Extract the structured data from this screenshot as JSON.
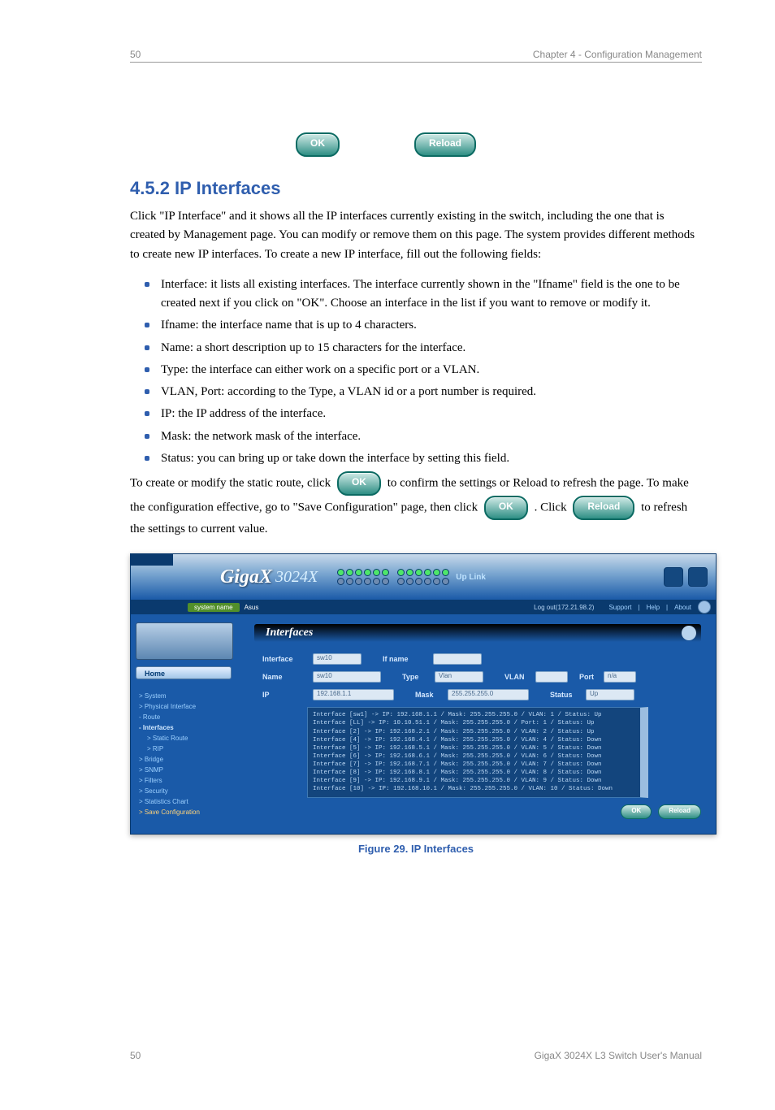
{
  "header": {
    "page_no_top": "50",
    "doc_title": "Chapter 4 - Configuration Management"
  },
  "buttons": {
    "ok": "OK",
    "reload": "Reload"
  },
  "section": {
    "title": "4.5.2 IP Interfaces",
    "para1": "Click \"IP Interface\" and it shows all the IP interfaces currently existing in the switch, including the one that is created by Management page. You can modify or remove them on this page. The system provides different methods to create new IP interfaces. To create a new IP interface, fill out the following fields:",
    "bullets": [
      "Interface: it lists all existing interfaces. The interface currently shown in the \"Ifname\" field is the one to be created next if you click on \"OK\". Choose an interface in the list if you want to remove or modify it.",
      "Ifname: the interface name that is up to 4 characters.",
      "Name: a short description up to 15 characters for the interface.",
      "Type: the interface can either work on a specific port or a VLAN.",
      "VLAN, Port: according to the Type, a VLAN id or a port number is required.",
      "IP: the IP address of the interface.",
      "Mask: the network mask of the interface.",
      "Status: you can bring up or take down the interface by setting this field."
    ],
    "para2_a": "To create or modify the static route, click ",
    "para2_b": " to confirm the settings or Reload to refresh the page. To make the configuration effective, go to \"Save Configuration\" page, then click ",
    "para2_c": ". Click ",
    "para2_d": " to refresh the settings to current value."
  },
  "figure": {
    "caption": "Figure 29. IP Interfaces",
    "logo": "GigaX",
    "model": "3024X",
    "uplink": "Up Link",
    "system_name_label": "system name",
    "system_name": "Asus",
    "logout": "Log out(172.21.98.2)",
    "top_links": [
      "Support",
      "Help",
      "About"
    ],
    "home": "Home",
    "nav": [
      {
        "label": "> System"
      },
      {
        "label": "> Physical Interface"
      },
      {
        "label": "- Route"
      },
      {
        "label": "- Interfaces",
        "bold": true
      },
      {
        "label": "> Static Route",
        "sub": true
      },
      {
        "label": "> RIP",
        "sub": true
      },
      {
        "label": "> Bridge"
      },
      {
        "label": "> SNMP"
      },
      {
        "label": "> Filters"
      },
      {
        "label": "> Security"
      },
      {
        "label": "> Statistics Chart"
      },
      {
        "label": "> Save Configuration",
        "save": true
      }
    ],
    "panel_title": "Interfaces",
    "form": {
      "interface_label": "Interface",
      "interface_value": "sw10",
      "ifname_label": "If name",
      "ifname_value": "",
      "name_label": "Name",
      "name_value": "sw10",
      "type_label": "Type",
      "type_value": "Vlan",
      "vlan_label": "VLAN",
      "vlan_value": "",
      "port_label": "Port",
      "port_value": "n/a",
      "ip_label": "IP",
      "ip_value": "192.168.1.1",
      "mask_label": "Mask",
      "mask_value": "255.255.255.0",
      "status_label": "Status",
      "status_value": "Up"
    },
    "listing": [
      "Interface [sw1] -> IP: 192.168.1.1 / Mask: 255.255.255.0 / VLAN: 1 / Status: Up",
      "Interface [LL] -> IP: 10.10.51.1 / Mask: 255.255.255.0 / Port: 1 / Status: Up",
      "Interface [2] -> IP: 192.168.2.1 / Mask: 255.255.255.0 / VLAN: 2 / Status: Up",
      "Interface [4] -> IP: 192.168.4.1 / Mask: 255.255.255.0 / VLAN: 4 / Status: Down",
      "Interface [5] -> IP: 192.168.5.1 / Mask: 255.255.255.0 / VLAN: 5 / Status: Down",
      "Interface [6] -> IP: 192.168.6.1 / Mask: 255.255.255.0 / VLAN: 6 / Status: Down",
      "Interface [7] -> IP: 192.168.7.1 / Mask: 255.255.255.0 / VLAN: 7 / Status: Down",
      "Interface [8] -> IP: 192.168.8.1 / Mask: 255.255.255.0 / VLAN: 8 / Status: Down",
      "Interface [9] -> IP: 192.168.9.1 / Mask: 255.255.255.0 / VLAN: 9 / Status: Down",
      "Interface [10] -> IP: 192.168.10.1 / Mask: 255.255.255.0 / VLAN: 10 / Status: Down"
    ],
    "btn_ok": "OK",
    "btn_reload": "Reload"
  },
  "footer": {
    "page_no": "50",
    "doc_title": "GigaX 3024X L3 Switch User's Manual"
  }
}
